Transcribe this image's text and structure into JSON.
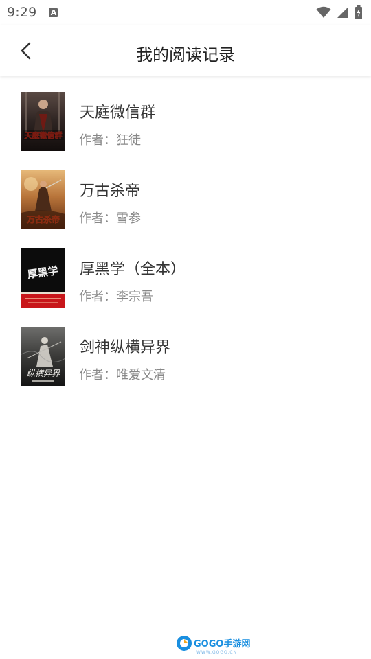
{
  "status_bar": {
    "time": "9:29",
    "notification_icon": "text-a-icon",
    "icons": [
      "wifi-icon",
      "cellular-signal-icon",
      "battery-charging-icon"
    ]
  },
  "header": {
    "title": "我的阅读记录",
    "back_icon": "chevron-left-icon"
  },
  "books": [
    {
      "title": "天庭微信群",
      "author": "作者：狂徒",
      "cover_text": "天庭微信群"
    },
    {
      "title": "万古杀帝",
      "author": "作者：雪参",
      "cover_text": "万古杀帝"
    },
    {
      "title": "厚黑学（全本）",
      "author": "作者：李宗吾",
      "cover_text": "厚黑学"
    },
    {
      "title": "剑神纵横异界",
      "author": "作者：唯爱文清",
      "cover_text": "纵横异界"
    }
  ],
  "watermark": {
    "logo": "GOGO手游网",
    "url": "WWW.GOGO.CN"
  },
  "colors": {
    "title_text": "#333333",
    "author_text": "#888888",
    "watermark_blue": "#1a8fe0"
  }
}
